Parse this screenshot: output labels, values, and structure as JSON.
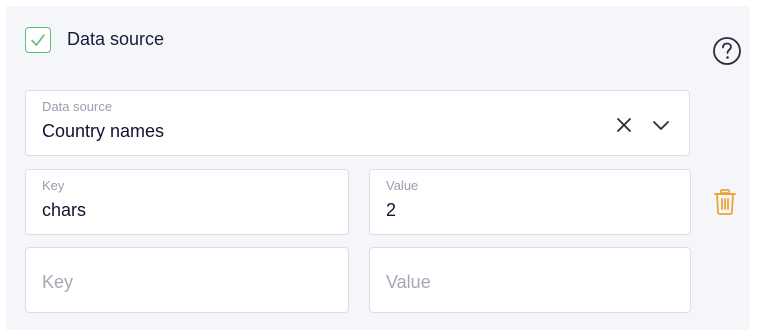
{
  "section": {
    "title": "Data source",
    "enabled": true
  },
  "icons": {
    "help": "question-circle-icon",
    "checkbox": "check-icon",
    "clear": "close-icon",
    "dropdown": "chevron-down-icon",
    "delete": "trash-icon"
  },
  "data_source_field": {
    "label": "Data source",
    "value": "Country names"
  },
  "params": [
    {
      "key_label": "Key",
      "key_value": "chars",
      "value_label": "Value",
      "value_value": "2"
    }
  ],
  "new_param": {
    "key_placeholder": "Key",
    "value_placeholder": "Value"
  },
  "colors": {
    "checkbox_accent": "#5fbf75",
    "delete_icon": "#f0a23a",
    "panel_bg": "#f5f6fa"
  }
}
